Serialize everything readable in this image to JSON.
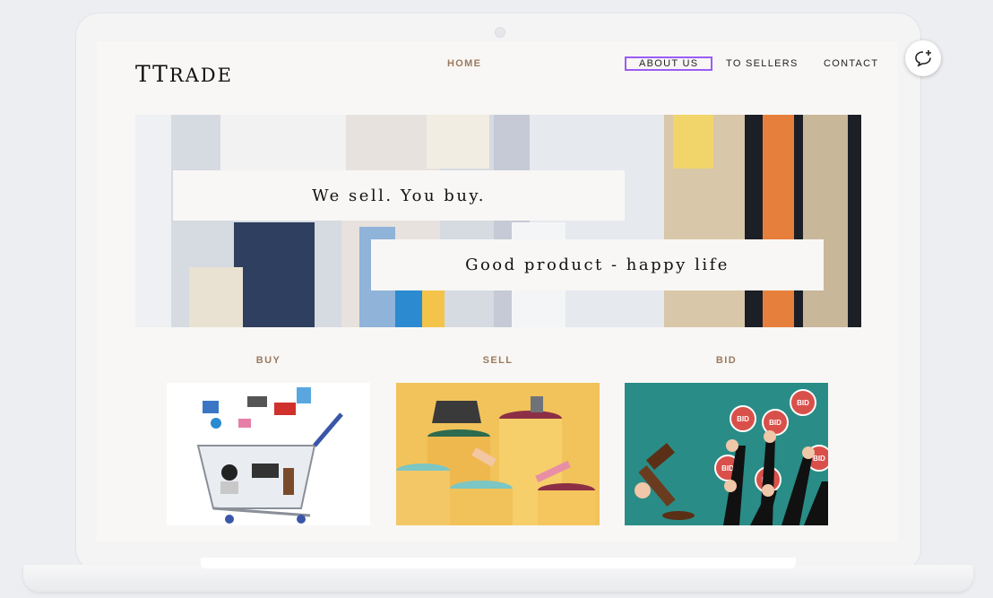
{
  "site": {
    "logo_big": "TT",
    "logo_small": "RADE"
  },
  "nav": {
    "items": [
      {
        "label": "HOME"
      },
      {
        "label": "ABOUT US"
      },
      {
        "label": "TO SELLERS"
      },
      {
        "label": "CONTACT"
      }
    ]
  },
  "hero": {
    "line1": "We sell. You buy.",
    "line2": "Good product - happy life"
  },
  "categories": [
    {
      "label": "BUY"
    },
    {
      "label": "SELL"
    },
    {
      "label": "BID"
    }
  ],
  "images": {
    "bid_paddle_text": "BID"
  },
  "colors": {
    "accent_brown": "#9a7a5e",
    "selection_purple": "#9b5cf6",
    "bid_bg": "#2a8c86"
  },
  "icons": {
    "chat": "chat-add-icon"
  }
}
